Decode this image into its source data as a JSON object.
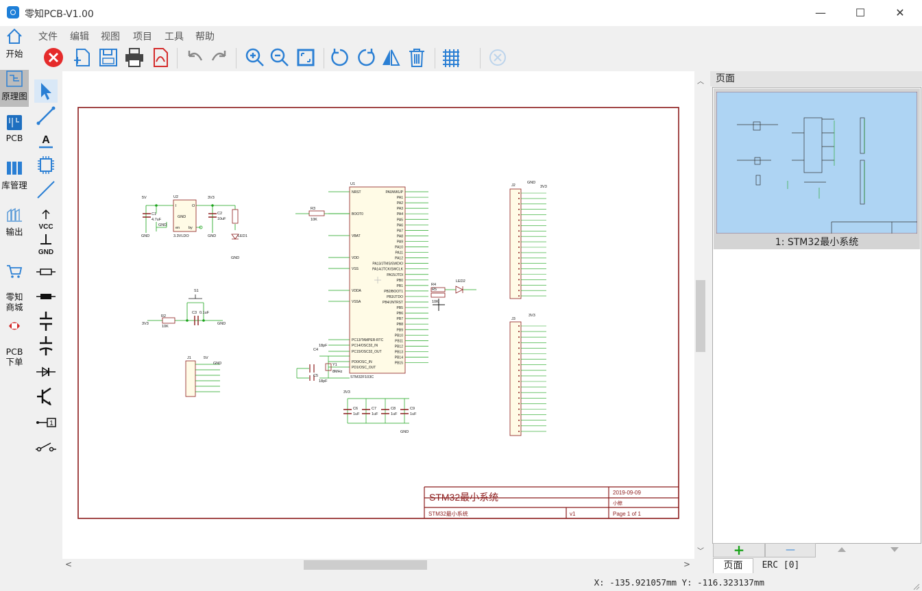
{
  "window": {
    "title": "零知PCB-V1.00",
    "minimize": "—",
    "maximize": "☐",
    "close": "✕"
  },
  "leftnav": [
    {
      "label": "开始",
      "icon": "home-icon"
    },
    {
      "label": "原理图",
      "icon": "schematic-icon",
      "active": true
    },
    {
      "label": "PCB",
      "icon": "pcb-icon"
    },
    {
      "label": "库管理",
      "icon": "library-icon"
    },
    {
      "label": "输出",
      "icon": "output-icon"
    },
    {
      "label": "零知\n商城",
      "icon": "shop-cart-icon"
    },
    {
      "label": "PCB\n下单",
      "icon": "pcb-order-icon"
    }
  ],
  "menu": [
    "文件",
    "编辑",
    "视图",
    "项目",
    "工具",
    "帮助"
  ],
  "toolbar": [
    "close-icon",
    "new-icon",
    "save-icon",
    "print-icon",
    "export-pdf-icon",
    "undo-icon",
    "redo-icon",
    "zoom-in-icon",
    "zoom-out-icon",
    "zoom-fit-icon",
    "rotate-ccw-icon",
    "rotate-cw-icon",
    "mirror-icon",
    "delete-icon",
    "grid-icon",
    "disabled-close-icon"
  ],
  "palette": {
    "text_tool": "A",
    "vcc_label": "VCC",
    "gnd_label": "GND",
    "pin_label": "1"
  },
  "schematic": {
    "refs": {
      "u1": "U1",
      "u2": "U2",
      "j1": "J1",
      "j2": "J2",
      "j3": "J3",
      "s1": "S1",
      "r2": "R2",
      "r3": "R3",
      "r4": "R4",
      "r5": "R5",
      "y1": "Y1",
      "c1": "C1",
      "c2": "C2",
      "c3": "C3",
      "c4": "C4",
      "c5": "C5",
      "c6": "C6",
      "c7": "C7",
      "c8": "C8",
      "c9": "C9",
      "led1": "LED1",
      "led2": "LED2"
    },
    "values": {
      "mcu": "STM32F103C",
      "ldo": "3.3VLDO",
      "r10k": "10K",
      "r10k_b": "10K",
      "r10k_c": "10K",
      "uf1": "1uF",
      "uf1_b": "1uF",
      "uf1_c": "1uF",
      "uf1_d": "1uF",
      "uf47": "4.7uF",
      "uf10": "10uF",
      "pf18": "18pF",
      "pf18_b": "18pF",
      "mhz8": "8MHz",
      "uf01": "0.1uF"
    },
    "net_labels": {
      "v5": "5V",
      "v5_b": "5V",
      "v33": "3V3",
      "gnd": "GND"
    },
    "u1_left_pins": [
      "NRST",
      "BOOT0",
      "VBAT",
      "VDD",
      "VSS",
      "VDDA",
      "VSSA",
      "PC13/TAMPER-RTC",
      "PC14/OSC32_IN",
      "PC15/OSC32_OUT",
      "PD0/OSC_IN",
      "PD1/OSC_OUT"
    ],
    "u1_right_pins": [
      "PA0/WKUP",
      "PA1",
      "PA2",
      "PA3",
      "PA4",
      "PA5",
      "PA6",
      "PA7",
      "PA8",
      "PA9",
      "PA10",
      "PA11",
      "PA12",
      "PA13/JTMS/SWDIO",
      "PA14/JTCK/SWCLK",
      "PA15/JTDI",
      "PB0",
      "PB1",
      "PB2/BOOT1",
      "PB3/JTDO",
      "PB4/JNTRST",
      "PB5",
      "PB6",
      "PB7",
      "PB8",
      "PB9",
      "PB10",
      "PB11",
      "PB12",
      "PB13",
      "PB14",
      "PB15"
    ],
    "u2_pins": {
      "in": "I",
      "out": "O",
      "gnd": "GND",
      "en": "en",
      "by": "by"
    },
    "title_block": {
      "title": "STM32最小系统",
      "date": "2019-09-09",
      "author": "小鲸",
      "sheet_name": "STM32最小系统",
      "rev": "v1",
      "page": "Page 1 of 1"
    }
  },
  "pages_panel": {
    "header": "页面",
    "page_label": "1: STM32最小系统",
    "add_button": "+",
    "remove_button": "—",
    "tab_pages": "页面",
    "tab_erc": "ERC [0]"
  },
  "status": {
    "coords": "X: -135.921057mm Y: -116.323137mm"
  },
  "colors": {
    "wire": "#1aa31a",
    "component": "#8b1a1a",
    "frame": "#8b1a1a",
    "thumb_bg": "#aed4f3",
    "accent": "#1e7fd8"
  }
}
